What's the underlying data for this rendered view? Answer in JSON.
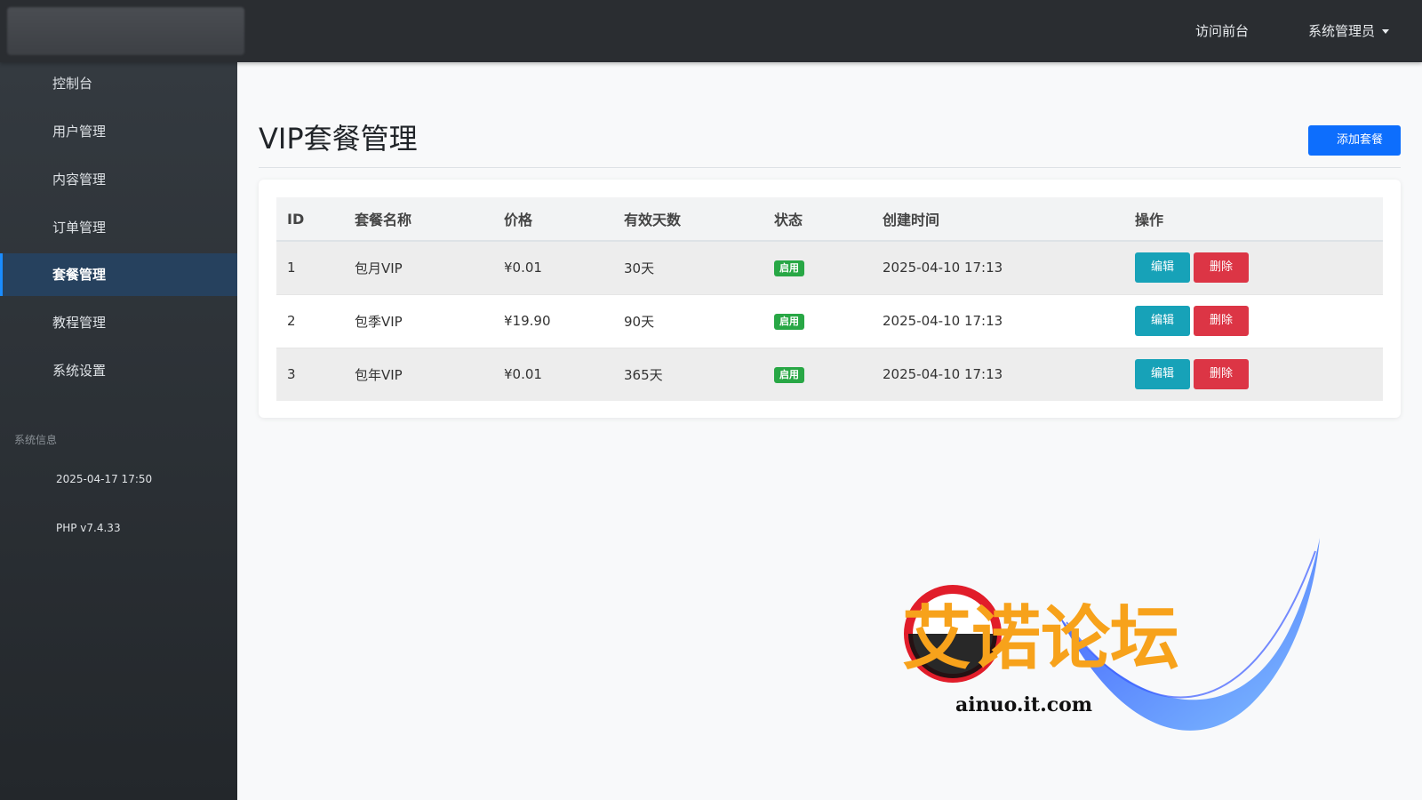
{
  "header": {
    "visit_front": "访问前台",
    "admin_user": "系统管理员"
  },
  "sidebar": {
    "items": [
      {
        "label": "控制台"
      },
      {
        "label": "用户管理"
      },
      {
        "label": "内容管理"
      },
      {
        "label": "订单管理"
      },
      {
        "label": "套餐管理",
        "active": true
      },
      {
        "label": "教程管理"
      },
      {
        "label": "系统设置"
      }
    ],
    "system_info": {
      "heading": "系统信息",
      "datetime": "2025-04-17 17:50",
      "php_version": "PHP v7.4.33"
    }
  },
  "main": {
    "title": "VIP套餐管理",
    "add_button": "添加套餐",
    "columns": [
      "ID",
      "套餐名称",
      "价格",
      "有效天数",
      "状态",
      "创建时间",
      "操作"
    ],
    "rows": [
      {
        "id": "1",
        "name": "包月VIP",
        "price": "¥0.01",
        "days": "30天",
        "status": "启用",
        "created": "2025-04-10 17:13"
      },
      {
        "id": "2",
        "name": "包季VIP",
        "price": "¥19.90",
        "days": "90天",
        "status": "启用",
        "created": "2025-04-10 17:13"
      },
      {
        "id": "3",
        "name": "包年VIP",
        "price": "¥0.01",
        "days": "365天",
        "status": "启用",
        "created": "2025-04-10 17:13"
      }
    ],
    "edit_label": "编辑",
    "delete_label": "删除"
  },
  "watermark": {
    "title": "艾诺论坛",
    "url": "ainuo.it.com"
  },
  "colors": {
    "primary": "#0d6efd",
    "info": "#17a2b8",
    "danger": "#dc3545",
    "success": "#28a745",
    "sidebar_active": "#26415e"
  }
}
